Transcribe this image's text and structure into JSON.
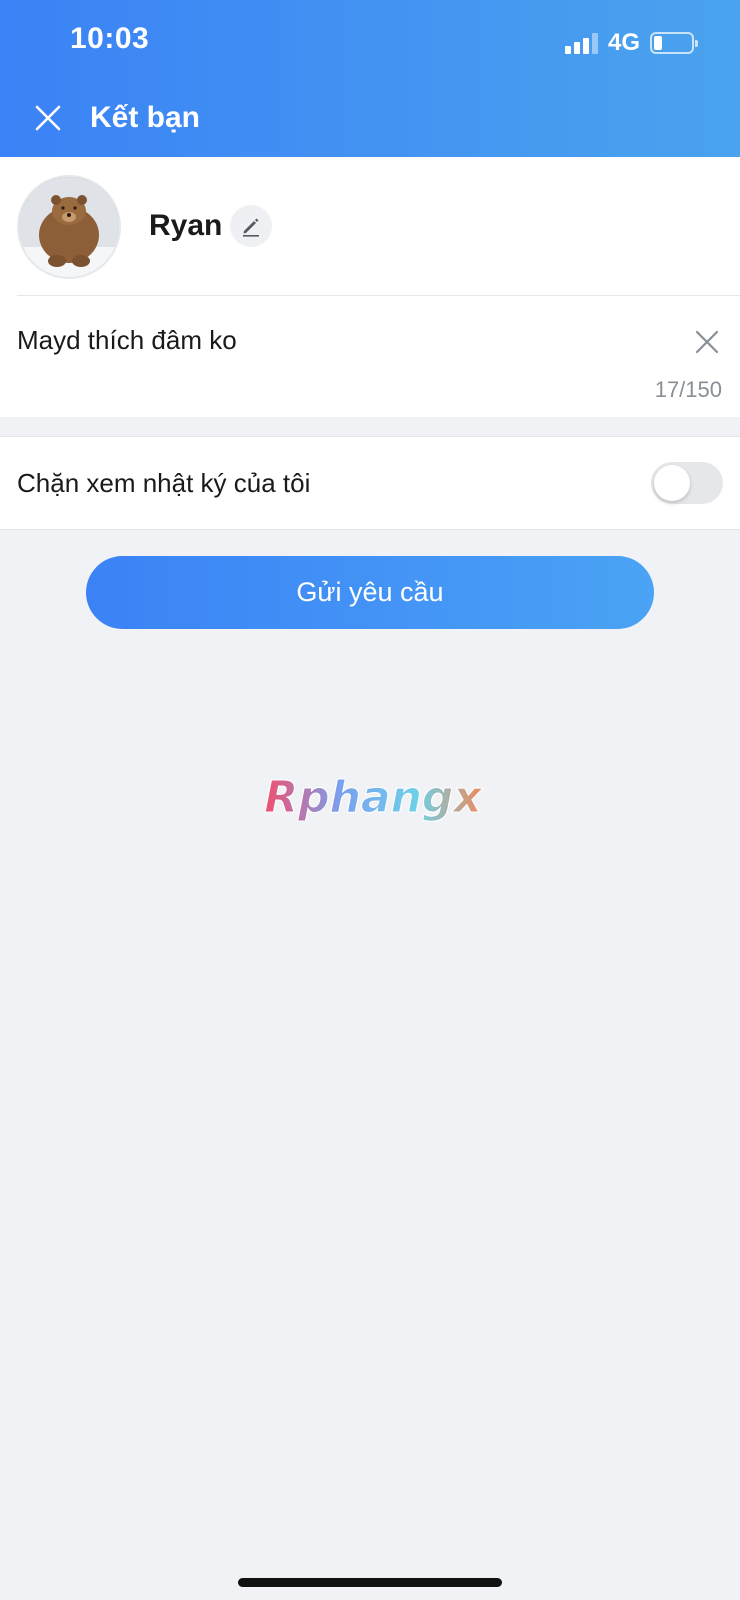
{
  "status_bar": {
    "time": "10:03",
    "network": "4G"
  },
  "header": {
    "title": "Kết bạn"
  },
  "profile": {
    "name": "Ryan"
  },
  "message": {
    "value": "Mayd thích đâm ko",
    "counter": "17/150"
  },
  "toggle_row": {
    "label": "Chặn xem nhật ký của tôi",
    "enabled": false
  },
  "send_button": {
    "label": "Gửi yêu cầu"
  },
  "watermark": {
    "text": "Rphangx"
  },
  "colors": {
    "accent": "#3b82f6",
    "accent_end": "#4aa3ee",
    "background": "#f1f2f5"
  }
}
